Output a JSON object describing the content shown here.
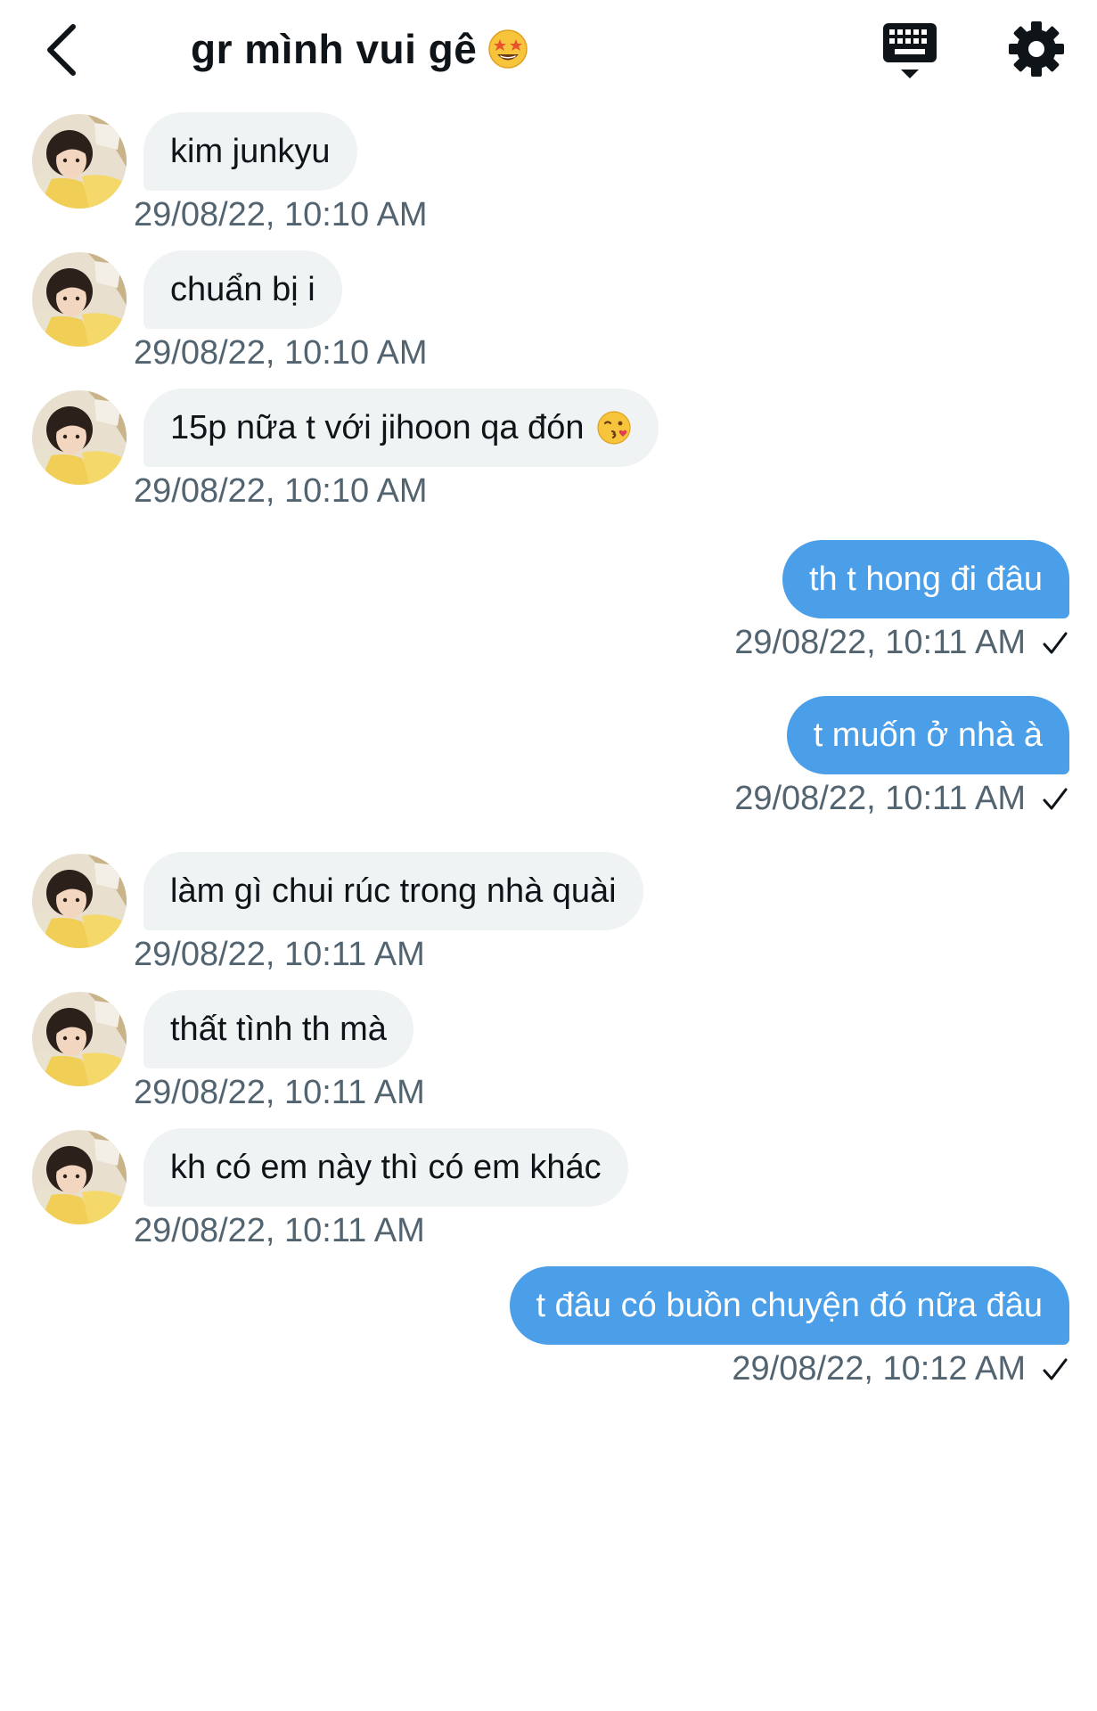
{
  "header": {
    "title": "gr mình vui gê",
    "title_emoji": "star-struck-emoji",
    "back_icon": "chevron-left-icon",
    "keyboard_icon": "keyboard-icon",
    "settings_icon": "gear-icon"
  },
  "colors": {
    "outgoing_bubble": "#4a9fe8",
    "incoming_bubble": "#eff3f4",
    "timestamp": "#536471"
  },
  "messages": [
    {
      "direction": "incoming",
      "text": "kim junkyu",
      "time": "29/08/22, 10:10 AM"
    },
    {
      "direction": "incoming",
      "text": "chuẩn bị i",
      "time": "29/08/22, 10:10 AM"
    },
    {
      "direction": "incoming",
      "text": "15p nữa t với jihoon qa đón",
      "emoji": "kissing-face-emoji",
      "time": "29/08/22, 10:10 AM"
    },
    {
      "direction": "outgoing",
      "text": "th t hong đi đâu",
      "time": "29/08/22, 10:11 AM"
    },
    {
      "direction": "outgoing",
      "text": "t muốn ở nhà à",
      "time": "29/08/22, 10:11 AM"
    },
    {
      "direction": "incoming",
      "text": "làm gì chui rúc trong nhà quài",
      "time": "29/08/22, 10:11 AM"
    },
    {
      "direction": "incoming",
      "text": "thất tình th mà",
      "time": "29/08/22, 10:11 AM"
    },
    {
      "direction": "incoming",
      "text": "kh có em này thì có em khác",
      "time": "29/08/22, 10:11 AM"
    },
    {
      "direction": "outgoing",
      "text": "t đâu có buồn chuyện đó nữa đâu",
      "time": "29/08/22, 10:12 AM"
    }
  ]
}
